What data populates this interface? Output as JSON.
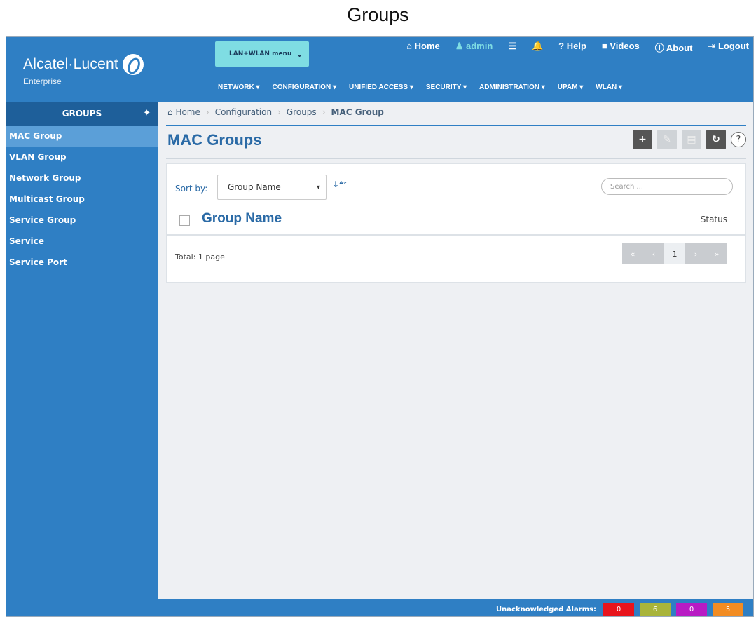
{
  "page_title": "Groups",
  "brand": {
    "name": "Alcatel·Lucent",
    "sub": "Enterprise"
  },
  "workspace": {
    "label": "LAN+WLAN menu"
  },
  "topnav": {
    "home": "Home",
    "admin": "admin",
    "help": "Help",
    "videos": "Videos",
    "about": "About",
    "logout": "Logout"
  },
  "mainnav": [
    "NETWORK ▾",
    "CONFIGURATION ▾",
    "UNIFIED ACCESS ▾",
    "SECURITY ▾",
    "ADMINISTRATION ▾",
    "UPAM ▾",
    "WLAN ▾"
  ],
  "sidebar": {
    "title": "GROUPS",
    "items": [
      {
        "label": "MAC Group",
        "active": true
      },
      {
        "label": "VLAN Group"
      },
      {
        "label": "Network Group"
      },
      {
        "label": "Multicast Group"
      },
      {
        "label": "Service Group"
      },
      {
        "label": "Service"
      },
      {
        "label": "Service Port"
      }
    ]
  },
  "breadcrumb": {
    "home": "Home",
    "b1": "Configuration",
    "b2": "Groups",
    "current": "MAC Group"
  },
  "main": {
    "heading": "MAC Groups",
    "sort_label": "Sort by:",
    "sort_value": "Group Name",
    "search_placeholder": "Search ...",
    "col_name": "Group Name",
    "col_status": "Status",
    "total": "Total: 1 page",
    "pager": {
      "first": "«",
      "prev": "‹",
      "page": "1",
      "next": "›",
      "last": "»"
    }
  },
  "footer": {
    "alarm_label": "Unacknowledged Alarms:",
    "alarms": [
      {
        "value": "0",
        "color": "#e8141c"
      },
      {
        "value": "6",
        "color": "#a8b43a"
      },
      {
        "value": "0",
        "color": "#b81bc4"
      },
      {
        "value": "5",
        "color": "#f28c22"
      }
    ]
  },
  "colors": {
    "brand_blue": "#2f7fc4",
    "sidebar_active": "#5b9fd8",
    "workspace": "#7fdde3"
  }
}
